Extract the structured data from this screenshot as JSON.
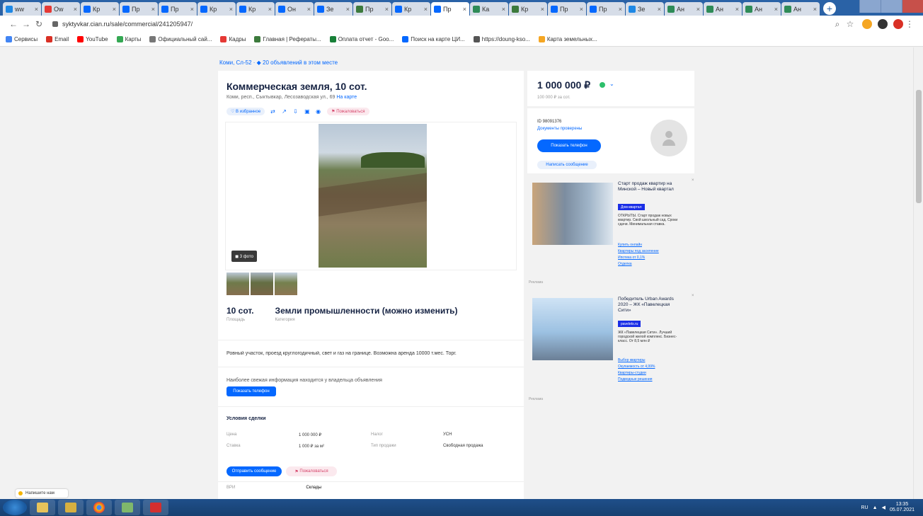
{
  "browser": {
    "tabs": [
      {
        "label": "ww",
        "fav": "#1e88e5"
      },
      {
        "label": "Ow",
        "fav": "#e53935"
      },
      {
        "label": "Кр",
        "fav": "#0468ff"
      },
      {
        "label": "Пр",
        "fav": "#0468ff"
      },
      {
        "label": "Пр",
        "fav": "#0468ff"
      },
      {
        "label": "Кр",
        "fav": "#0468ff"
      },
      {
        "label": "Кр",
        "fav": "#0468ff"
      },
      {
        "label": "Он",
        "fav": "#0468ff"
      },
      {
        "label": "Зе",
        "fav": "#0468ff"
      },
      {
        "label": "Пр",
        "fav": "#3c7a3c"
      },
      {
        "label": "Кр",
        "fav": "#0468ff"
      },
      {
        "label": "Пр",
        "fav": "#0468ff",
        "active": true
      },
      {
        "label": "Ка",
        "fav": "#2e8b57"
      },
      {
        "label": "Кр",
        "fav": "#3c7a3c"
      },
      {
        "label": "Пр",
        "fav": "#0468ff"
      },
      {
        "label": "Пр",
        "fav": "#0468ff"
      },
      {
        "label": "Зе",
        "fav": "#1e88e5"
      },
      {
        "label": "Ан",
        "fav": "#2e8b57"
      },
      {
        "label": "Ан",
        "fav": "#2e8b57"
      },
      {
        "label": "Ан",
        "fav": "#2e8b57"
      },
      {
        "label": "Ан",
        "fav": "#2e8b57"
      }
    ],
    "url": "syktyvkar.cian.ru/sale/commercial/241205947/",
    "bookmarks": [
      {
        "label": "Сервисы",
        "color": "#4285f4"
      },
      {
        "label": "Email",
        "color": "#d93025"
      },
      {
        "label": "YouTube",
        "color": "#ff0000"
      },
      {
        "label": "Карты",
        "color": "#34a853"
      },
      {
        "label": "Официальный сай...",
        "color": "#777"
      },
      {
        "label": "Кадры",
        "color": "#e53935"
      },
      {
        "label": "Главная | Рефераты...",
        "color": "#3c7a3c"
      },
      {
        "label": "Оплата отчет - Goo...",
        "color": "#188038"
      },
      {
        "label": "Поиск на карте ЦИ...",
        "color": "#0468ff"
      },
      {
        "label": "https://doung-kso...",
        "color": "#555"
      },
      {
        "label": "Карта земельных...",
        "color": "#f5a623"
      }
    ]
  },
  "page": {
    "breadcrumb": "Коми, Сл-52 · ◆ 20 объявлений в этом месте",
    "title": "Коммерческая земля, 10 сот.",
    "address": "Коми, респ., Сыктывкар, Лесозаводская ул., 69",
    "address_link": "На карте",
    "chips": {
      "favorite": "В избранное",
      "complain": "Пожаловаться"
    },
    "photo_count": "◼ 3 фото",
    "facts": [
      {
        "value": "10 сот.",
        "label": "Площадь"
      },
      {
        "value": "Земли промышленности (можно изменить)",
        "label": "Категория"
      }
    ],
    "description": "Ровный участок, проезд круглогодичный, свет и газ на границе. Возможна аренда 10000 т.мес. Торг.",
    "note": "Наиболее свежая информация находится у владельца объявления",
    "show_phone": "Показать телефон",
    "terms_title": "Условия сделки",
    "terms": [
      {
        "k1": "Цена",
        "v1": "1 000 000 ₽",
        "k2": "Налог",
        "v2": "УСН"
      },
      {
        "k1": "Ставка",
        "v1": "1 000 ₽ за м²",
        "k2": "Тип продажи",
        "v2": "Свободная продажа"
      }
    ],
    "write_message": "Отправить сообщение",
    "complain_bottom": "Пожаловаться",
    "more_k": "ВРИ",
    "more_v": "Склады"
  },
  "sidebar": {
    "price": "1 000 000 ₽",
    "price_sub": "100 000 ₽ за сот.",
    "seller_id": "ID 98091376",
    "seller_docs": "Документы проверены",
    "show_phone": "Показать телефон",
    "write_message": "Написать сообщение",
    "ads": [
      {
        "title": "Старт продаж квартир на Минской – Новый квартал",
        "badge": "Дом-квартал",
        "body": "ОТКРЫТЫ. Старт продаж новых квартир. Свой школьный сад. Сроки сдачи. Минимальная ставка.",
        "links": [
          "Купить онлайн",
          "Квартиры под заселение",
          "Ипотека от 0,1%",
          "Отделка"
        ],
        "mark": "Реклама"
      },
      {
        "title": "Победитель Urban Awards 2020 – ЖК «Павелецкая Сити»",
        "badge": "pavelets.ru",
        "body": "ЖК «Павелецкая Сити». Лучший городской жилой комплекс. Бизнес-класс. От 8,5 млн ₽",
        "links": [
          "Выбор квартиры",
          "Окупаемость от 4,99%",
          "Квартиры-студии",
          "Подводные решения"
        ],
        "mark": "Реклама"
      }
    ]
  },
  "chat_widget": "Напишите нам",
  "taskbar": {
    "time": "13:35",
    "date": "05.07.2021",
    "lang": "RU"
  }
}
